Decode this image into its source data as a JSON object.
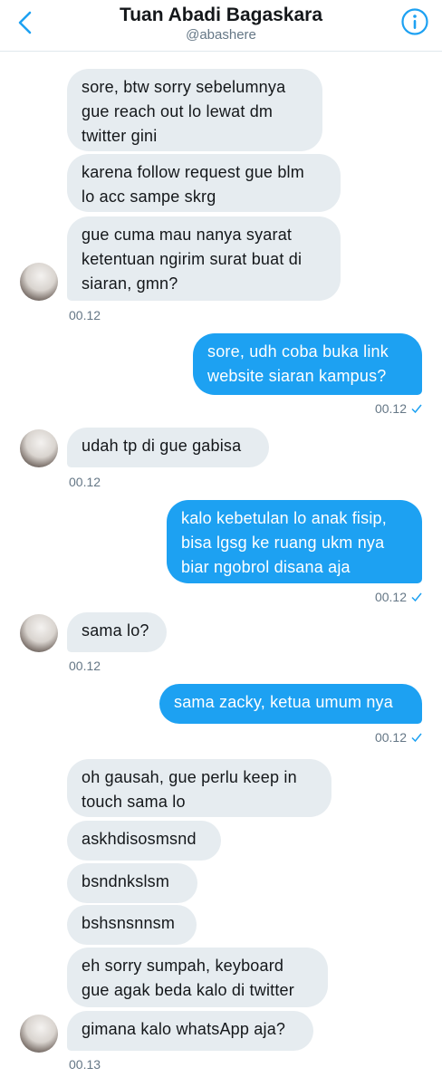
{
  "header": {
    "name": "Tuan Abadi Bagaskara",
    "handle": "@abashere"
  },
  "messages": {
    "m1": "sore, btw sorry sebelumnya",
    "m1b": "gue reach out lo lewat dm",
    "m1c": "twitter gini",
    "m2": "karena follow request gue blm",
    "m2b": "lo acc sampe skrg",
    "m3": "gue cuma mau nanya syarat",
    "m3b": "ketentuan ngirim surat buat di",
    "m3c": "siaran, gmn?",
    "t1": "00.12",
    "m4": "sore, udh coba buka link",
    "m4b": "website siaran kampus?",
    "t2": "00.12",
    "m5": "udah tp di gue gabisa",
    "t3": "00.12",
    "m6": "kalo kebetulan lo anak fisip,",
    "m6b": "bisa lgsg ke ruang ukm nya",
    "m6c": "biar ngobrol disana aja",
    "t4": "00.12",
    "m7": "sama lo?",
    "t5": "00.12",
    "m8": "sama zacky, ketua umum nya",
    "t6": "00.12",
    "m9": "oh gausah, gue perlu keep in",
    "m9b": "touch sama lo",
    "m10": "askhdisosmsnd",
    "m11": "bsndnkslsm",
    "m12": "bshsnsnnsm",
    "m13": "eh sorry sumpah, keyboard",
    "m13b": "gue agak beda kalo di twitter",
    "m14": "gimana kalo whatsApp aja?",
    "t7": "00.13"
  },
  "colors": {
    "accent": "#1da1f2",
    "incoming_bubble": "#e6ecf0",
    "muted": "#657786"
  },
  "icons": {
    "back": "chevron-left-icon",
    "info": "info-icon",
    "read": "check-icon"
  }
}
